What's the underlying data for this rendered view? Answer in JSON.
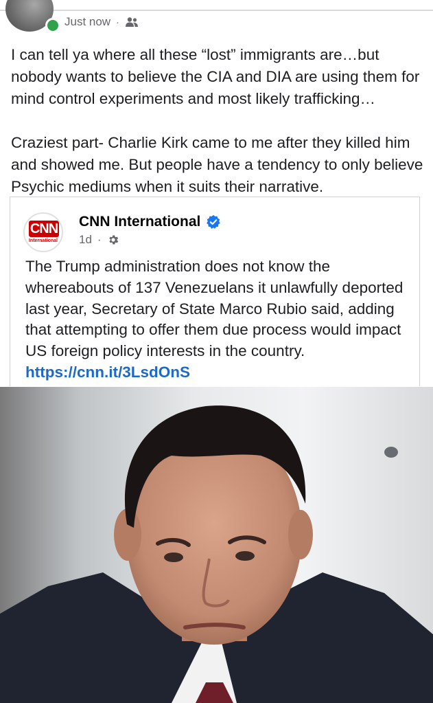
{
  "post": {
    "timestamp": "Just now",
    "separator": "·",
    "audience_icon": "friends-icon",
    "paragraphs": [
      "I can tell ya where all these “lost” immigrants are…but nobody wants to believe the CIA and DIA are using them for mind control experiments and most likely trafficking…",
      "Craziest part- Charlie Kirk came to me after they killed him and showed me. But people have a tendency to only believe Psychic mediums when it suits their narrative."
    ]
  },
  "shared": {
    "logo_text": "CNN",
    "logo_subtext": "International",
    "page_name": "CNN International",
    "verified_icon": "verified-badge-icon",
    "age": "1d",
    "separator": "·",
    "visibility_icon": "gear-icon",
    "text": "The Trump administration does not know the whereabouts of 137 Venezuelans it unlawfully deported last year, Secretary of State Marco Rubio said, adding that attempting to offer them due process would impact US foreign policy interests in the country.",
    "link": "https://cnn.it/3LsdOnS"
  },
  "colors": {
    "online": "#31a24c",
    "link": "#1b6ac9",
    "verified": "#1877f2",
    "cnn_red": "#cc0000"
  }
}
